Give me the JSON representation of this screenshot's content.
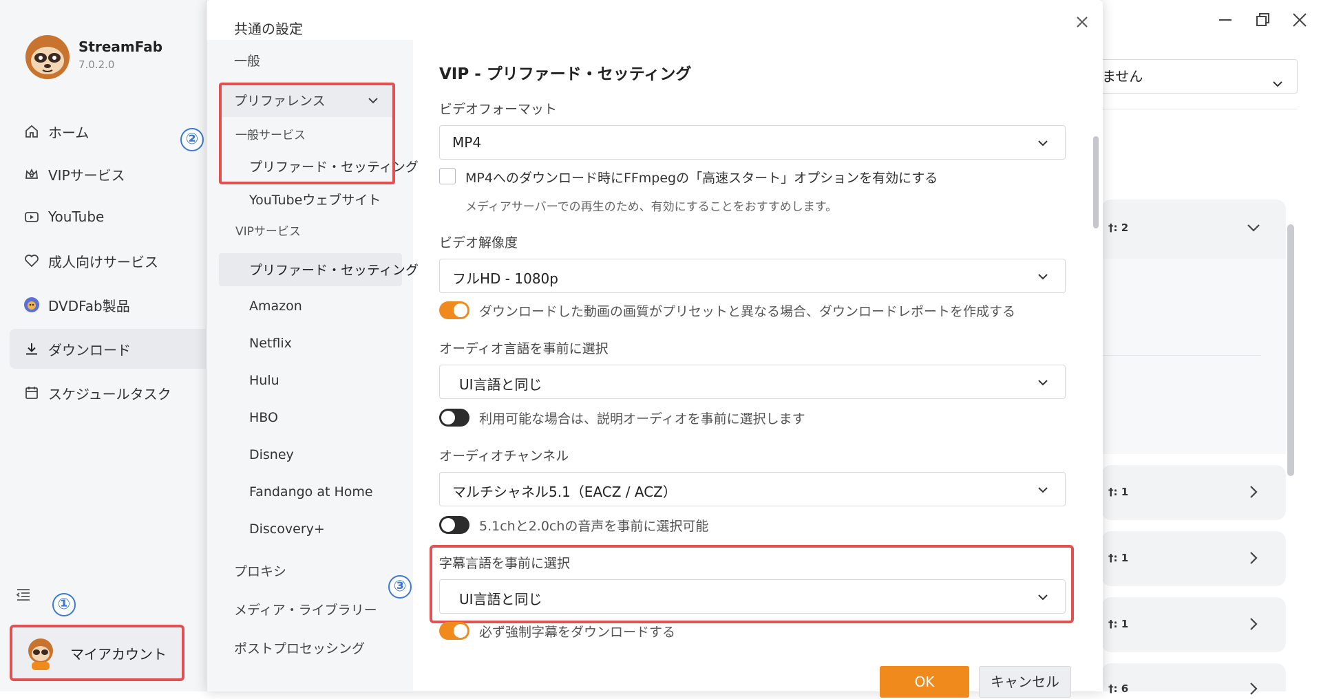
{
  "app": {
    "name": "StreamFab",
    "version": "7.0.2.0",
    "nav": [
      {
        "label": "ホーム",
        "icon": "home-icon"
      },
      {
        "label": "VIPサービス",
        "icon": "vip-crown-icon"
      },
      {
        "label": "YouTube",
        "icon": "youtube-icon"
      },
      {
        "label": "成人向けサービス",
        "icon": "heart-icon"
      },
      {
        "label": "DVDFab製品",
        "icon": "dvdfab-logo-icon"
      },
      {
        "label": "ダウンロード",
        "icon": "download-icon",
        "active": true
      },
      {
        "label": "スケジュールタスク",
        "icon": "calendar-icon"
      }
    ],
    "account_label": "マイアカウント"
  },
  "badges": {
    "one": "①",
    "two": "②",
    "three": "③"
  },
  "background_window": {
    "select_value": "ません",
    "cards": [
      {
        "text": "†: 2"
      },
      {
        "text": "†: 1"
      },
      {
        "text": "†: 1"
      },
      {
        "text": "†: 1"
      },
      {
        "text": "†: 6"
      }
    ]
  },
  "dialog": {
    "title": "共通の設定",
    "nav": {
      "general": "一般",
      "preferences": "プリファレンス",
      "general_services": "一般サービス",
      "preferred_settings_1": "プリファード・セッティング",
      "youtube_site": "YouTubeウェブサイト",
      "vip_services": "VIPサービス",
      "preferred_settings_2": "プリファード・セッティング",
      "amazon": "Amazon",
      "netflix": "Netflix",
      "hulu": "Hulu",
      "hbo": "HBO",
      "disney": "Disney",
      "fandango": "Fandango at Home",
      "discovery": "Discovery+",
      "proxy": "プロキシ",
      "media_library": "メディア・ライブラリー",
      "post_processing": "ポストプロセッシング"
    },
    "content": {
      "title": "VIP - プリファード・セッティング",
      "video_format_label": "ビデオフォーマット",
      "video_format_value": "MP4",
      "faststart_checkbox": "MP4へのダウンロード時にFFmpegの「高速スタート」オプションを有効にする",
      "faststart_hint": "メディアサーバーでの再生のため、有効にすることをおすすめします。",
      "resolution_label": "ビデオ解像度",
      "resolution_value": "フルHD - 1080p",
      "report_toggle": "ダウンロードした動画の画質がプリセットと異なる場合、ダウンロードレポートを作成する",
      "audio_lang_label": "オーディオ言語を事前に選択",
      "audio_lang_value": "UI言語と同じ",
      "descriptive_audio_toggle": "利用可能な場合は、説明オーディオを事前に選択します",
      "audio_channel_label": "オーディオチャンネル",
      "audio_channel_value": "マルチシャネル5.1（EACZ / ACZ）",
      "channel_toggle": "5.1chと2.0chの音声を事前に選択可能",
      "subtitle_lang_label": "字幕言語を事前に選択",
      "subtitle_lang_value": "UI言語と同じ",
      "forced_subs_toggle": "必ず強制字幕をダウンロードする"
    },
    "buttons": {
      "ok": "OK",
      "cancel": "キャンセル"
    }
  },
  "colors": {
    "accent": "#f08a1c",
    "highlight": "#e05252",
    "badge": "#3a78d6"
  }
}
